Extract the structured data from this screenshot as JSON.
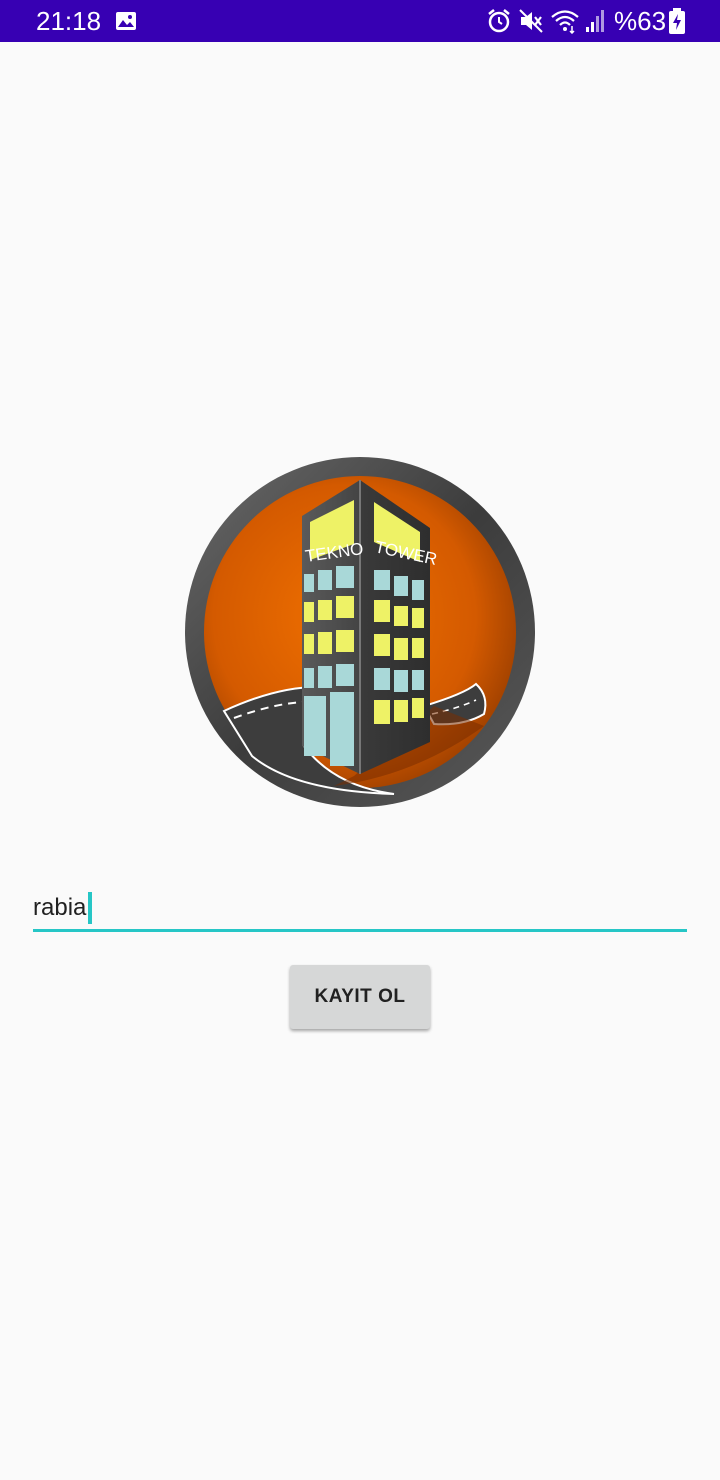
{
  "status_bar": {
    "time": "21:18",
    "battery_percent": "%63",
    "icons": [
      "image-icon",
      "alarm-icon",
      "mute-icon",
      "wifi-icon",
      "signal-icon",
      "battery-charging-icon"
    ],
    "background_color": "#3700b3"
  },
  "logo": {
    "word_1": "TEKNO",
    "word_2": "TOWER",
    "accent_color": "#e06000"
  },
  "name_input": {
    "value": "rabia",
    "underline_color": "#26c6c6"
  },
  "register_button": {
    "label": "KAYIT OL"
  }
}
